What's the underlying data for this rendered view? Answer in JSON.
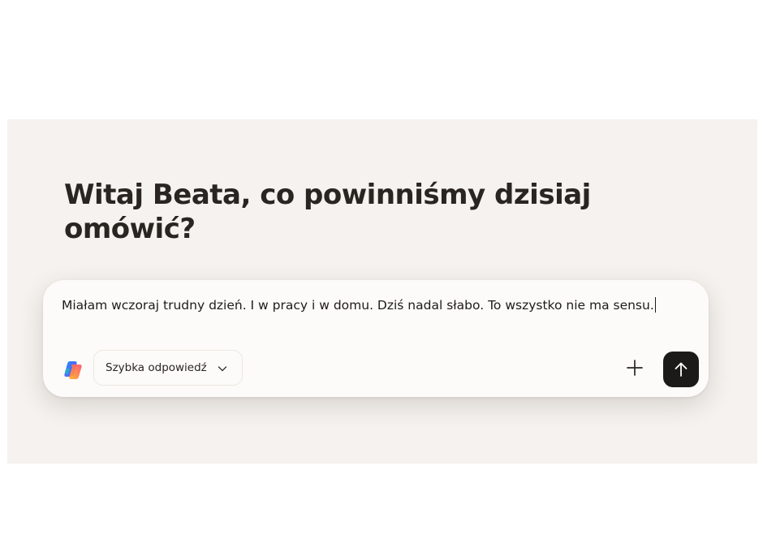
{
  "greeting": {
    "line1": "Witaj Beata, co powinniśmy dzisiaj",
    "line2": "omówić?"
  },
  "composer": {
    "message": "Miałam wczoraj trudny dzień. I w pracy i w domu. Dziś nadal słabo. To wszystko nie ma sensu.",
    "mode_label": "Szybka odpowiedź"
  },
  "icons": {
    "logo": "copilot-logo-icon",
    "chevron": "chevron-down-icon",
    "add": "plus-icon",
    "send": "arrow-up-icon"
  },
  "colors": {
    "panel_background": "#f5f2ef",
    "composer_background": "#fcfbf9",
    "text": "#1f1b18",
    "send_button": "#1c1a18"
  }
}
